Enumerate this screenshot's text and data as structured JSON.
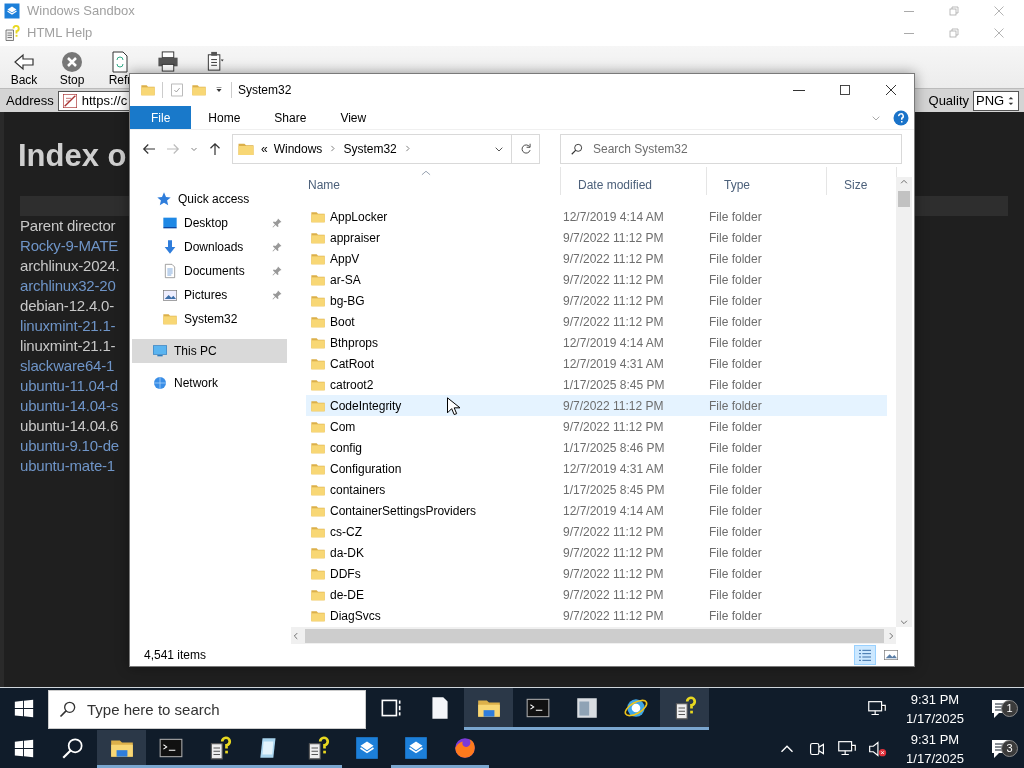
{
  "sandbox_window": {
    "title": "Windows Sandbox"
  },
  "help_window": {
    "title": "HTML Help",
    "toolbar": [
      {
        "kind": "back",
        "label": "Back"
      },
      {
        "kind": "stop",
        "label": "Stop"
      },
      {
        "kind": "refresh",
        "label": "Refr"
      },
      {
        "kind": "print"
      },
      {
        "kind": "options"
      }
    ],
    "address_label": "Address",
    "address": "https://c",
    "quality_label": "Quality",
    "quality": "PNG",
    "page": {
      "heading": "Index o",
      "links": [
        {
          "text": "Parent director",
          "visited": true
        },
        {
          "text": "Rocky-9-MATE",
          "visited": false
        },
        {
          "text": "archlinux-2024.",
          "visited": true
        },
        {
          "text": "archlinux32-20",
          "visited": false
        },
        {
          "text": "debian-12.4.0-",
          "visited": true
        },
        {
          "text": "linuxmint-21.1-",
          "visited": false
        },
        {
          "text": "linuxmint-21.1-",
          "visited": true
        },
        {
          "text": "slackware64-1",
          "visited": false
        },
        {
          "text": "ubuntu-11.04-d",
          "visited": false
        },
        {
          "text": "ubuntu-14.04-s",
          "visited": false
        },
        {
          "text": "ubuntu-14.04.6",
          "visited": true
        },
        {
          "text": "ubuntu-9.10-de",
          "visited": false
        },
        {
          "text": "ubuntu-mate-1",
          "visited": false
        }
      ]
    }
  },
  "explorer": {
    "title": "System32",
    "ribbon_tabs": [
      {
        "label": "File",
        "selected": true
      },
      {
        "label": "Home",
        "selected": false
      },
      {
        "label": "Share",
        "selected": false
      },
      {
        "label": "View",
        "selected": false
      }
    ],
    "path_overflow": "«",
    "path": [
      "Windows",
      "System32"
    ],
    "search": {
      "placeholder": "Search System32"
    },
    "nav": [
      {
        "label": "Quick access",
        "kind": "star",
        "selected": false,
        "children": [
          {
            "label": "Desktop",
            "kind": "desktop",
            "pinned": true,
            "selected": false
          },
          {
            "label": "Downloads",
            "kind": "download",
            "pinned": true,
            "selected": false
          },
          {
            "label": "Documents",
            "kind": "document",
            "pinned": true,
            "selected": false
          },
          {
            "label": "Pictures",
            "kind": "pictures",
            "pinned": true,
            "selected": false
          },
          {
            "label": "System32",
            "kind": "folder",
            "pinned": false,
            "selected": false
          }
        ]
      },
      {
        "label": "This PC",
        "kind": "pc",
        "selected": true
      },
      {
        "label": "Network",
        "kind": "network",
        "selected": false
      }
    ],
    "columns": [
      {
        "label": "Name",
        "sorted": true
      },
      {
        "label": "Date modified",
        "sorted": false
      },
      {
        "label": "Type",
        "sorted": false
      },
      {
        "label": "Size",
        "sorted": false
      }
    ],
    "rows": [
      {
        "name": "AppLocker",
        "date": "12/7/2019 4:14 AM",
        "type": "File folder",
        "hovered": false
      },
      {
        "name": "appraiser",
        "date": "9/7/2022 11:12 PM",
        "type": "File folder",
        "hovered": false
      },
      {
        "name": "AppV",
        "date": "9/7/2022 11:12 PM",
        "type": "File folder",
        "hovered": false
      },
      {
        "name": "ar-SA",
        "date": "9/7/2022 11:12 PM",
        "type": "File folder",
        "hovered": false
      },
      {
        "name": "bg-BG",
        "date": "9/7/2022 11:12 PM",
        "type": "File folder",
        "hovered": false
      },
      {
        "name": "Boot",
        "date": "9/7/2022 11:12 PM",
        "type": "File folder",
        "hovered": false
      },
      {
        "name": "Bthprops",
        "date": "12/7/2019 4:14 AM",
        "type": "File folder",
        "hovered": false
      },
      {
        "name": "CatRoot",
        "date": "12/7/2019 4:31 AM",
        "type": "File folder",
        "hovered": false
      },
      {
        "name": "catroot2",
        "date": "1/17/2025 8:45 PM",
        "type": "File folder",
        "hovered": false
      },
      {
        "name": "CodeIntegrity",
        "date": "9/7/2022 11:12 PM",
        "type": "File folder",
        "hovered": true
      },
      {
        "name": "Com",
        "date": "9/7/2022 11:12 PM",
        "type": "File folder",
        "hovered": false
      },
      {
        "name": "config",
        "date": "1/17/2025 8:46 PM",
        "type": "File folder",
        "hovered": false
      },
      {
        "name": "Configuration",
        "date": "12/7/2019 4:31 AM",
        "type": "File folder",
        "hovered": false
      },
      {
        "name": "containers",
        "date": "1/17/2025 8:45 PM",
        "type": "File folder",
        "hovered": false
      },
      {
        "name": "ContainerSettingsProviders",
        "date": "12/7/2019 4:14 AM",
        "type": "File folder",
        "hovered": false
      },
      {
        "name": "cs-CZ",
        "date": "9/7/2022 11:12 PM",
        "type": "File folder",
        "hovered": false
      },
      {
        "name": "da-DK",
        "date": "9/7/2022 11:12 PM",
        "type": "File folder",
        "hovered": false
      },
      {
        "name": "DDFs",
        "date": "9/7/2022 11:12 PM",
        "type": "File folder",
        "hovered": false
      },
      {
        "name": "de-DE",
        "date": "9/7/2022 11:12 PM",
        "type": "File folder",
        "hovered": false
      },
      {
        "name": "DiagSvcs",
        "date": "9/7/2022 11:12 PM",
        "type": "File folder",
        "hovered": false
      }
    ],
    "status": "4,541 items",
    "views": [
      {
        "kind": "details",
        "selected": true
      },
      {
        "kind": "large",
        "selected": false
      }
    ]
  },
  "taskbars": [
    {
      "search_placeholder": "Type here to search",
      "apps": [
        {
          "kind": "taskview",
          "running": false,
          "active": false
        },
        {
          "kind": "file",
          "running": false,
          "active": false
        },
        {
          "kind": "explorer",
          "running": true,
          "active": true
        },
        {
          "kind": "cmd",
          "running": true,
          "active": false
        },
        {
          "kind": "app",
          "running": true,
          "active": false
        },
        {
          "kind": "ie",
          "running": true,
          "active": false
        },
        {
          "kind": "help",
          "running": true,
          "active": true
        }
      ],
      "tray": [
        {
          "kind": "network"
        }
      ],
      "time": "9:31 PM",
      "date": "1/17/2025",
      "notifications": "1"
    },
    {
      "apps": [
        {
          "kind": "search",
          "running": false,
          "active": false
        },
        {
          "kind": "explorer",
          "running": true,
          "active": true
        },
        {
          "kind": "cmd",
          "running": true,
          "active": false
        },
        {
          "kind": "help",
          "running": true,
          "active": false
        },
        {
          "kind": "notepad",
          "running": true,
          "active": false
        },
        {
          "kind": "help",
          "running": true,
          "active": false
        },
        {
          "kind": "sandbox",
          "running": false,
          "active": false
        },
        {
          "kind": "sandbox",
          "running": true,
          "active": false
        },
        {
          "kind": "firefox",
          "running": true,
          "active": false
        }
      ],
      "tray": [
        {
          "kind": "chevron"
        },
        {
          "kind": "camera"
        },
        {
          "kind": "network"
        },
        {
          "kind": "muted"
        }
      ],
      "time": "9:31 PM",
      "date": "1/17/2025",
      "notifications": "3"
    }
  ]
}
